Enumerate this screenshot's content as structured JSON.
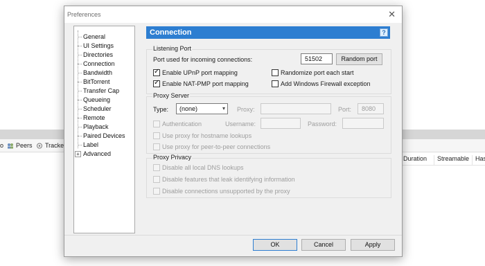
{
  "background": {
    "tabs": [
      {
        "icon": "peers-icon",
        "label": "Peers"
      },
      {
        "icon": "trackers-icon",
        "label": "Trackers"
      }
    ],
    "tab_prefix": "o",
    "columns": [
      "Duration",
      "Streamable",
      "Has"
    ]
  },
  "dialog": {
    "title": "Preferences",
    "close_glyph": "✕",
    "tree": [
      "General",
      "UI Settings",
      "Directories",
      "Connection",
      "Bandwidth",
      "BitTorrent",
      "Transfer Cap",
      "Queueing",
      "Scheduler",
      "Remote",
      "Playback",
      "Paired Devices",
      "Label",
      "Advanced"
    ],
    "tree_expander": "+",
    "section_title": "Connection",
    "help_glyph": "?",
    "listening_port": {
      "title": "Listening Port",
      "port_label": "Port used for incoming connections:",
      "port_value": "51502",
      "random_button": "Random port",
      "upnp_label": "Enable UPnP port mapping",
      "upnp_checked": true,
      "natpmp_label": "Enable NAT-PMP port mapping",
      "natpmp_checked": true,
      "randomize_label": "Randomize port each start",
      "randomize_checked": false,
      "firewall_label": "Add Windows Firewall exception",
      "firewall_checked": false
    },
    "proxy_server": {
      "title": "Proxy Server",
      "type_label": "Type:",
      "type_value": "(none)",
      "proxy_label": "Proxy:",
      "proxy_value": "",
      "port_label": "Port:",
      "port_value": "8080",
      "auth_label": "Authentication",
      "username_label": "Username:",
      "password_label": "Password:",
      "hostname_label": "Use proxy for hostname lookups",
      "p2p_label": "Use proxy for peer-to-peer connections"
    },
    "proxy_privacy": {
      "title": "Proxy Privacy",
      "dns_label": "Disable all local DNS lookups",
      "leak_label": "Disable features that leak identifying information",
      "unsupported_label": "Disable connections unsupported by the proxy"
    },
    "buttons": {
      "ok": "OK",
      "cancel": "Cancel",
      "apply": "Apply"
    },
    "check_glyph": "✓",
    "dropdown_glyph": "▾"
  },
  "colors": {
    "accent": "#2d7ed1",
    "dialog_bg": "#f0f0f0"
  }
}
